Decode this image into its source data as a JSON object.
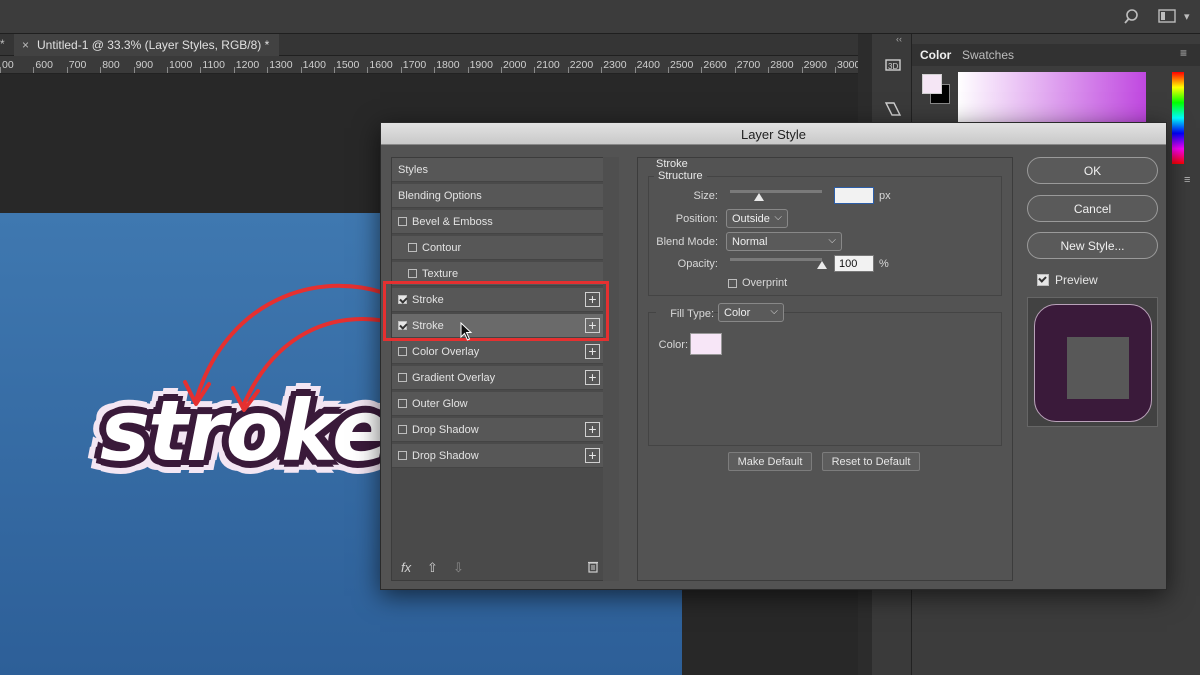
{
  "document_tab": {
    "close": "×",
    "title": "Untitled-1 @ 33.3% (Layer Styles, RGB/8) *",
    "left_star": "*"
  },
  "ruler": {
    "ticks": [
      "00",
      "600",
      "700",
      "800",
      "900",
      "1000",
      "1100",
      "1200",
      "1300",
      "1400",
      "1500",
      "1600",
      "1700",
      "1800",
      "1900",
      "2000",
      "2100",
      "2200",
      "2300",
      "2400",
      "2500",
      "2600",
      "2700",
      "2800",
      "2900",
      "3000"
    ]
  },
  "canvas": {
    "word": "stroke"
  },
  "panel": {
    "tab_color": "Color",
    "tab_swatches": "Swatches",
    "collapse": "‹‹",
    "foreground_color": "#f5e6f5"
  },
  "dialog": {
    "title": "Layer Style",
    "styles": [
      {
        "label": "Styles",
        "has_checkbox": false
      },
      {
        "label": "Blending Options",
        "has_checkbox": false
      },
      {
        "label": "Bevel & Emboss",
        "has_checkbox": true,
        "checked": false
      },
      {
        "label": "Contour",
        "has_checkbox": true,
        "checked": false
      },
      {
        "label": "Texture",
        "has_checkbox": true,
        "checked": false
      },
      {
        "label": "Stroke",
        "has_checkbox": true,
        "checked": true,
        "plus": true
      },
      {
        "label": "Stroke",
        "has_checkbox": true,
        "checked": true,
        "plus": true
      },
      {
        "label": "Color Overlay",
        "has_checkbox": true,
        "checked": false,
        "plus": true
      },
      {
        "label": "Gradient Overlay",
        "has_checkbox": true,
        "checked": false,
        "plus": true
      },
      {
        "label": "Outer Glow",
        "has_checkbox": true,
        "checked": false
      },
      {
        "label": "Drop Shadow",
        "has_checkbox": true,
        "checked": false,
        "plus": true
      },
      {
        "label": "Drop Shadow",
        "has_checkbox": true,
        "checked": false,
        "plus": true
      }
    ],
    "footer": {
      "fx": "fx",
      "up": "⇧",
      "down": "⇩",
      "trash": "🗑"
    },
    "stroke": {
      "section": "Stroke",
      "structure": "Structure",
      "size_label": "Size:",
      "size_value": "",
      "size_unit": "px",
      "size_level": 0.32,
      "position_label": "Position:",
      "position_value": "Outside",
      "blend_label": "Blend Mode:",
      "blend_value": "Normal",
      "opacity_label": "Opacity:",
      "opacity_value": "100",
      "opacity_unit": "%",
      "opacity_level": 1.0,
      "overprint_label": "Overprint",
      "fill_type_label": "Fill Type:",
      "fill_type_value": "Color",
      "color_label": "Color:",
      "color_value": "#f7e6f7",
      "make_default": "Make Default",
      "reset_default": "Reset to Default"
    },
    "buttons": {
      "ok": "OK",
      "cancel": "Cancel",
      "new_style": "New Style...",
      "preview": "Preview"
    }
  },
  "annotation_color": "#e53030"
}
